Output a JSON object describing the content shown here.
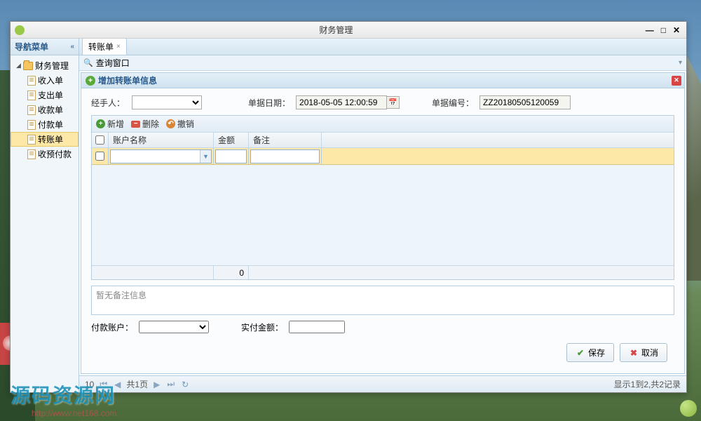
{
  "window": {
    "title": "财务管理"
  },
  "sidebar": {
    "header": "导航菜单",
    "root": "财务管理",
    "items": [
      "收入单",
      "支出单",
      "收款单",
      "付款单",
      "转账单",
      "收预付款"
    ],
    "selected_index": 4
  },
  "tab": {
    "label": "转账单"
  },
  "searchbar": {
    "label": "查询窗口"
  },
  "panel": {
    "title": "增加转账单信息"
  },
  "form": {
    "handler_label": "经手人：",
    "date_label": "单据日期：",
    "date_value": "2018-05-05 12:00:59",
    "docno_label": "单据编号：",
    "docno_value": "ZZ20180505120059"
  },
  "grid": {
    "toolbar": {
      "add": "新增",
      "delete": "删除",
      "undo": "撤销"
    },
    "columns": {
      "account": "账户名称",
      "amount": "金额",
      "remark": "备注"
    },
    "footer_total": "0"
  },
  "remark": {
    "placeholder": "暂无备注信息"
  },
  "bottom": {
    "pay_account_label": "付款账户：",
    "actual_amount_label": "实付金额："
  },
  "actions": {
    "save": "保存",
    "cancel": "取消"
  },
  "pager": {
    "page_label_prefix": "共",
    "page_label_suffix": "页",
    "page_total": "1",
    "page_current": "10",
    "info": "显示1到2,共2记录"
  },
  "watermark": {
    "text": "源码资源网",
    "url": "http://www.net168.com"
  }
}
